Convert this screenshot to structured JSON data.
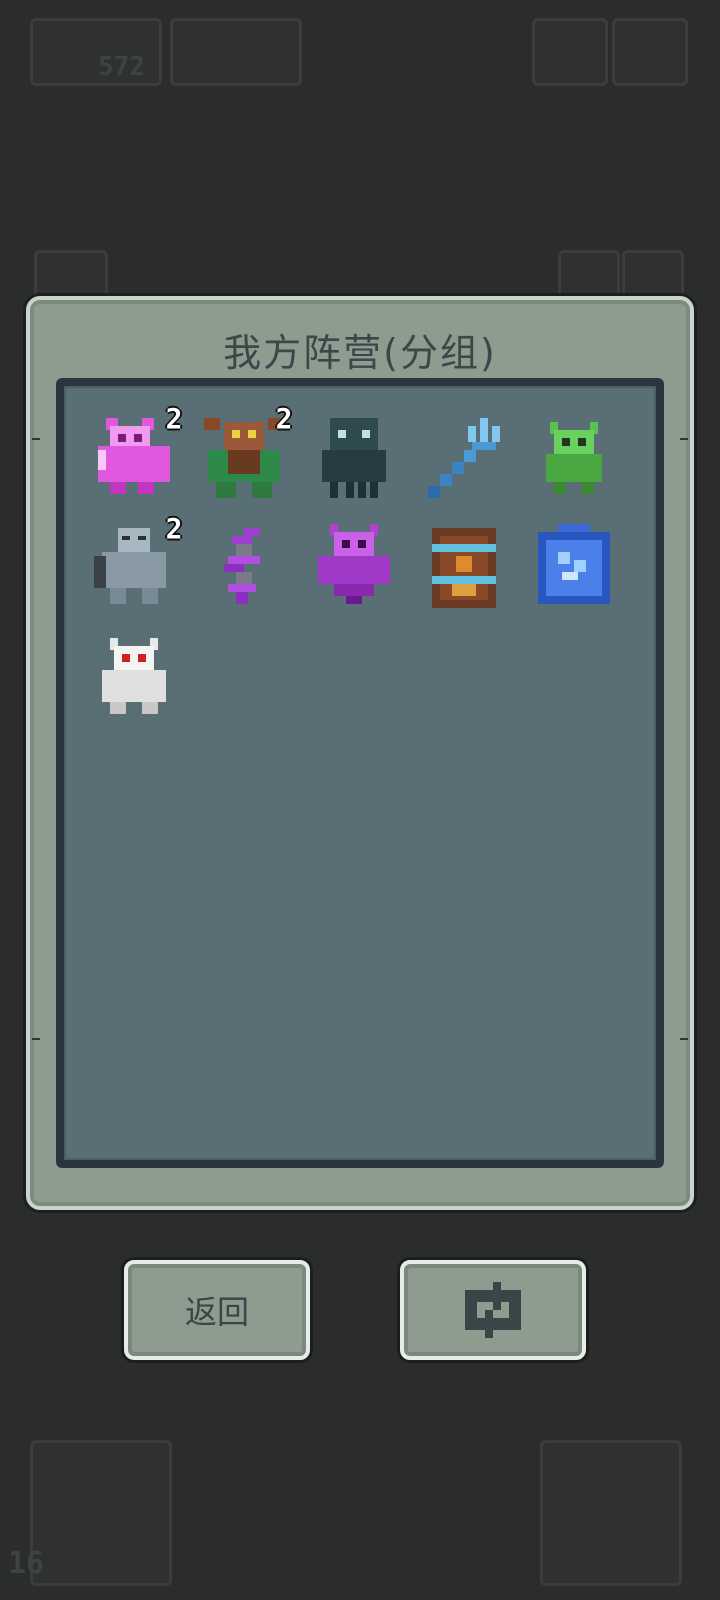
{
  "hud": {
    "top_counter": "572",
    "bottom_counter": "16"
  },
  "panel": {
    "title": "我方阵营(分组)"
  },
  "units": [
    {
      "name": "pink-demon",
      "count": "2"
    },
    {
      "name": "minotaur",
      "count": "2"
    },
    {
      "name": "cthulhu",
      "count": ""
    },
    {
      "name": "ice-trident",
      "count": ""
    },
    {
      "name": "green-goblin",
      "count": ""
    },
    {
      "name": "stone-golem",
      "count": "2"
    },
    {
      "name": "purple-spirit",
      "count": ""
    },
    {
      "name": "purple-demon",
      "count": ""
    },
    {
      "name": "chained-totem",
      "count": ""
    },
    {
      "name": "blue-portal",
      "count": ""
    },
    {
      "name": "white-beast",
      "count": ""
    }
  ],
  "buttons": {
    "back_label": "返回",
    "refresh_icon": "refresh-icon"
  },
  "colors": {
    "panel": "#8e9c90",
    "panel_inner": "#5a6e76",
    "badge": "#ffffff"
  }
}
